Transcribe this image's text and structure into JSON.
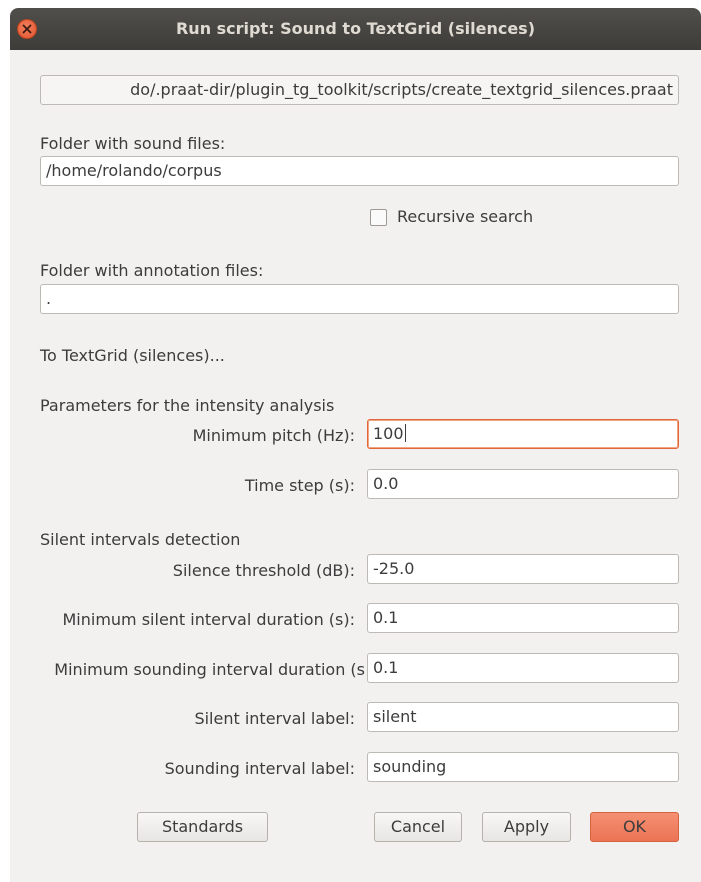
{
  "window": {
    "title": "Run script: Sound to TextGrid (silences)"
  },
  "script_path": "do/.praat-dir/plugin_tg_toolkit/scripts/create_textgrid_silences.praat",
  "sound_folder": {
    "label": "Folder with sound files:",
    "value": "/home/rolando/corpus"
  },
  "recursive": {
    "label": "Recursive search",
    "checked": false
  },
  "annotation_folder": {
    "label": "Folder with annotation files:",
    "value": "."
  },
  "section_totg": "To TextGrid (silences)...",
  "intensity": {
    "heading": "Parameters for the intensity analysis",
    "min_pitch_label": "Minimum pitch (Hz):",
    "min_pitch_value": "100",
    "time_step_label": "Time step (s):",
    "time_step_value": "0.0"
  },
  "silence": {
    "heading": "Silent intervals detection",
    "threshold_label": "Silence threshold (dB):",
    "threshold_value": "-25.0",
    "min_silent_label": "Minimum silent interval duration (s):",
    "min_silent_value": "0.1",
    "min_sounding_label": "Minimum sounding interval duration (s",
    "min_sounding_value": "0.1",
    "silent_label_label": "Silent interval label:",
    "silent_label_value": "silent",
    "sounding_label_label": "Sounding interval label:",
    "sounding_label_value": "sounding"
  },
  "buttons": {
    "standards": "Standards",
    "cancel": "Cancel",
    "apply": "Apply",
    "ok": "OK"
  },
  "colors": {
    "accent": "#ec7455",
    "titlebar": "#3d3c38",
    "dialog_bg": "#f2f1f0"
  }
}
